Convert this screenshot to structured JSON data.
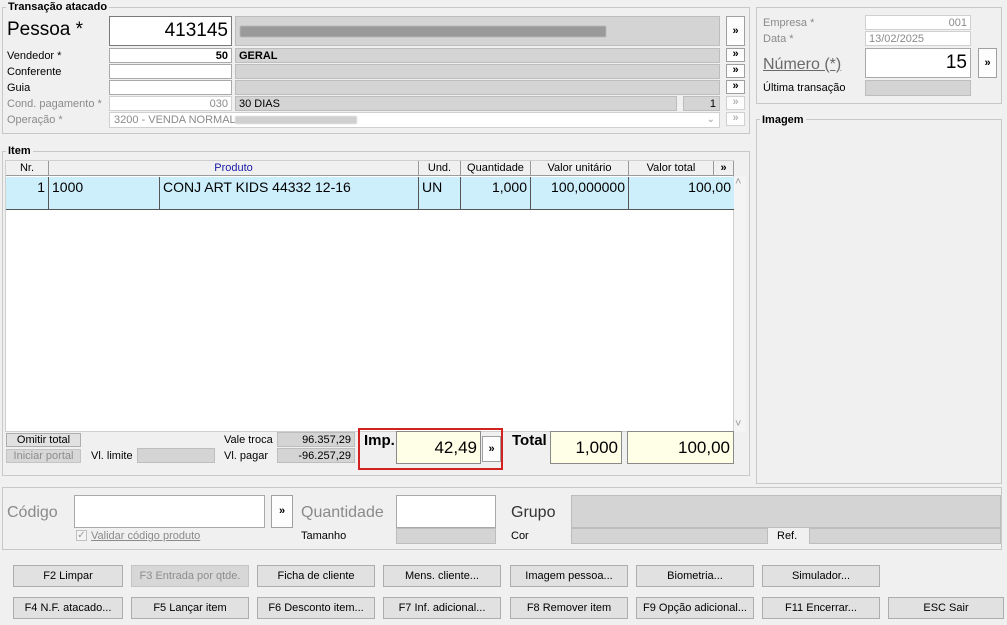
{
  "transacao": {
    "group_title": "Transação atacado",
    "pessoa_label": "Pessoa *",
    "pessoa_value": "413145",
    "vendedor_label": "Vendedor *",
    "vendedor_value": "50",
    "vendedor_name": "GERAL",
    "conferente_label": "Conferente",
    "guia_label": "Guia",
    "cond_label": "Cond. pagamento *",
    "cond_value": "030",
    "cond_name": "30 DIAS",
    "cond_num": "1",
    "operacao_label": "Operação *",
    "operacao_value": "3200 - VENDA NORMAL",
    "more_symbol": "»"
  },
  "empresa": {
    "empresa_label": "Empresa *",
    "empresa_value": "001",
    "data_label": "Data *",
    "data_value": "13/02/2025",
    "numero_label": "Número (*)",
    "numero_value": "15",
    "ultima_label": "Última transação",
    "imagem_title": "Imagem"
  },
  "item": {
    "group_title": "Item",
    "columns": [
      "Nr.",
      "Produto",
      "Und.",
      "Quantidade",
      "Valor unitário",
      "Valor total"
    ],
    "rows": [
      {
        "nr": "1",
        "codigo": "1000",
        "produto": "CONJ ART KIDS 44332 12-16",
        "und": "UN",
        "quantidade": "1,000",
        "valor_unitario": "100,000000",
        "valor_total": "100,00"
      }
    ]
  },
  "footer": {
    "omitir_total": "Omitir total",
    "iniciar_portal": "Iniciar portal",
    "vl_limite_label": "Vl. limite",
    "vale_troca_label": "Vale troca",
    "vale_troca_value": "96.357,29",
    "vl_pagar_label": "Vl. pagar",
    "vl_pagar_value": "-96.257,29",
    "imp_label": "Imp.",
    "imp_value": "42,49",
    "total_label": "Total",
    "total_qty": "1,000",
    "total_value": "100,00"
  },
  "entry": {
    "codigo_label": "Código",
    "validar_label": "Validar código produto",
    "quantidade_label": "Quantidade",
    "tamanho_label": "Tamanho",
    "grupo_label": "Grupo",
    "cor_label": "Cor",
    "ref_label": "Ref."
  },
  "buttons": {
    "row1": [
      "F2 Limpar",
      "F3 Entrada por qtde.",
      "Ficha de cliente",
      "Mens. cliente...",
      "Imagem pessoa...",
      "Biometria...",
      "Simulador..."
    ],
    "row2": [
      "F4 N.F. atacado...",
      "F5 Lançar item",
      "F6 Desconto item...",
      "F7 Inf. adicional...",
      "F8 Remover item",
      "F9 Opção adicional...",
      "F11 Encerrar...",
      "ESC Sair"
    ]
  }
}
